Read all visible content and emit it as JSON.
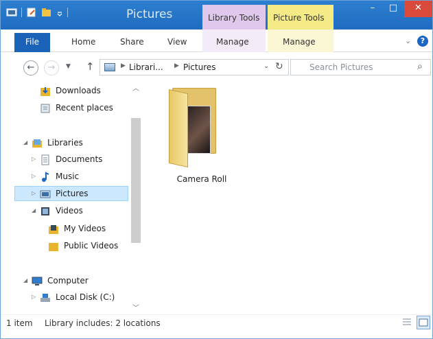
{
  "titlebar": {
    "title": "Pictures",
    "context_tabs": {
      "library_tools": "Library Tools",
      "picture_tools": "Picture Tools"
    },
    "buttons": {
      "minimize": "–",
      "maximize": "□",
      "close": "✕"
    }
  },
  "ribbon": {
    "tabs": [
      "File",
      "Home",
      "Share",
      "View",
      "Manage",
      "Manage"
    ],
    "help": "?"
  },
  "address": {
    "breadcrumbs": [
      "Librari...",
      "Pictures"
    ],
    "search_placeholder": "Search Pictures"
  },
  "navpane": {
    "items": [
      {
        "label": "Downloads",
        "icon": "downloads-icon"
      },
      {
        "label": "Recent places",
        "icon": "recent-places-icon"
      },
      {
        "label": "Libraries",
        "icon": "libraries-icon"
      },
      {
        "label": "Documents",
        "icon": "documents-icon"
      },
      {
        "label": "Music",
        "icon": "music-icon"
      },
      {
        "label": "Pictures",
        "icon": "pictures-icon",
        "selected": true
      },
      {
        "label": "Videos",
        "icon": "videos-icon"
      },
      {
        "label": "My Videos",
        "icon": "folder-icon"
      },
      {
        "label": "Public Videos",
        "icon": "folder-icon"
      },
      {
        "label": "Computer",
        "icon": "computer-icon"
      },
      {
        "label": "Local Disk (C:)",
        "icon": "disk-icon"
      }
    ]
  },
  "content": {
    "items": [
      {
        "label": "Camera Roll",
        "icon": "folder-photo-icon"
      }
    ]
  },
  "statusbar": {
    "count": "1 item",
    "library_info": "Library includes: 2 locations"
  },
  "colors": {
    "titlebar": "#2d7fd0",
    "file_tab": "#1a63b9",
    "selection": "#cce8ff",
    "close": "#d94a3b"
  }
}
